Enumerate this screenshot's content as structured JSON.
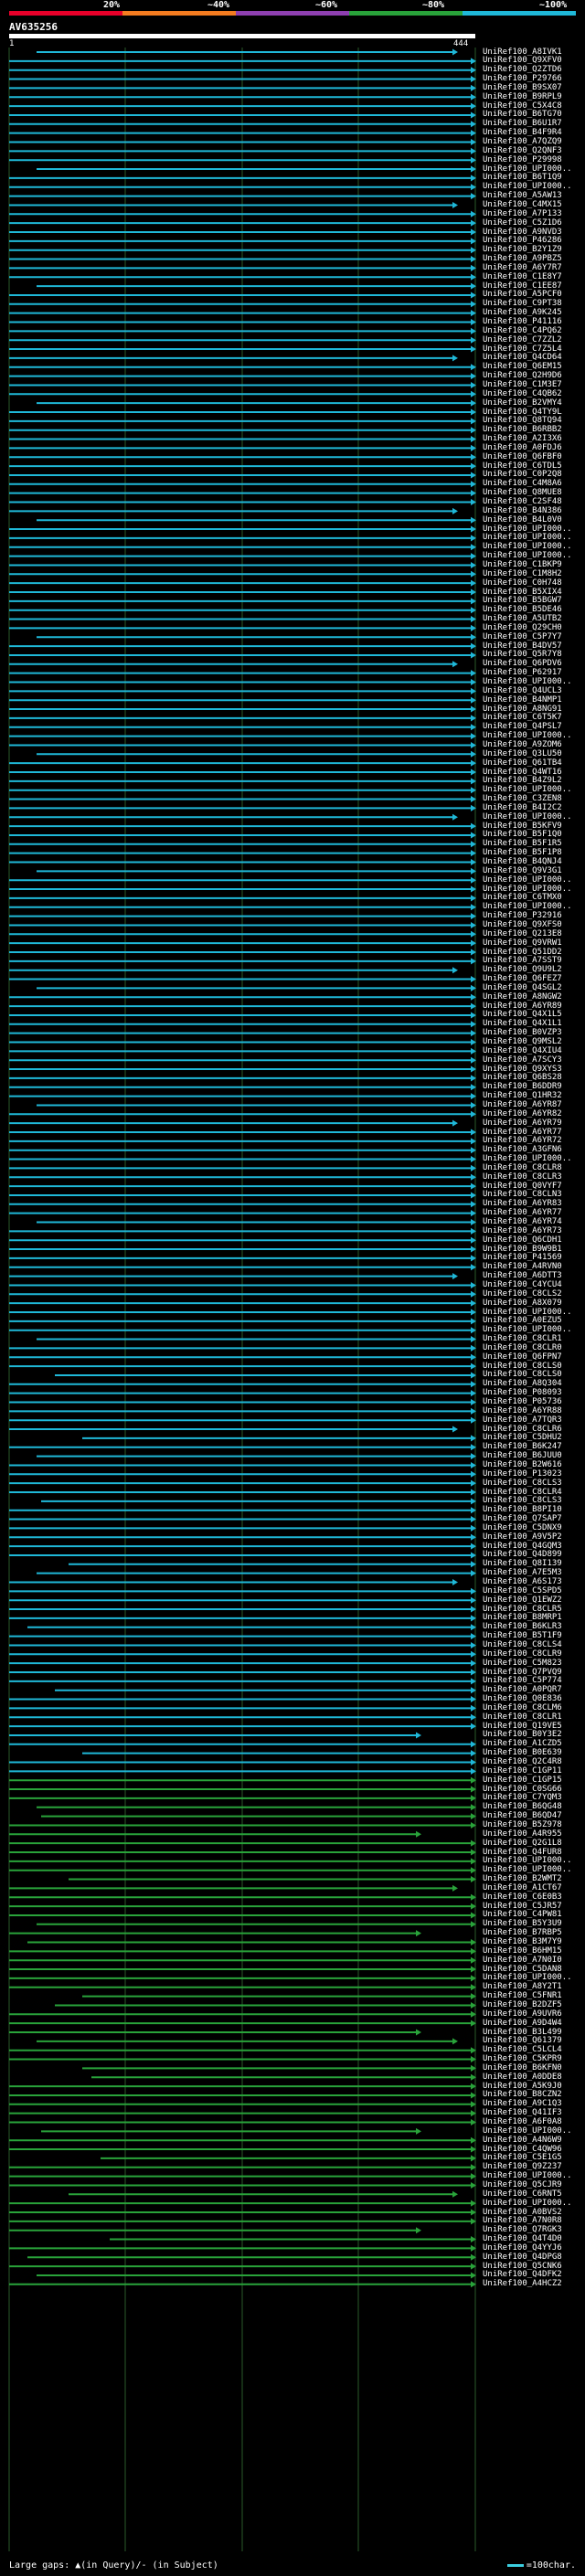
{
  "legend": {
    "ticks": [
      "20%",
      "~40%",
      "~60%",
      "~80%",
      "~100%"
    ],
    "colors": [
      "#e8002a",
      "#f47c20",
      "#8e3fb0",
      "#29a33a",
      "#1fb8d8"
    ]
  },
  "query": {
    "name": "AV635256",
    "start": "1",
    "end": "444"
  },
  "hits": {
    "labels": [
      "UniRef100_A8IVK1",
      "UniRef100_Q9XFV0",
      "UniRef100_Q2ZTD6",
      "UniRef100_P29766",
      "UniRef100_B9SX07",
      "UniRef100_B9RPL9",
      "UniRef100_C5X4C8",
      "UniRef100_B6TG70",
      "UniRef100_B6U1R7",
      "UniRef100_B4F9R4",
      "UniRef100_A7QZQ9",
      "UniRef100_Q2QNF3",
      "UniRef100_P29998",
      "UniRef100_UPI000..",
      "UniRef100_B6T1Q9",
      "UniRef100_UPI000..",
      "UniRef100_A5AW13",
      "UniRef100_C4MX15",
      "UniRef100_A7P133",
      "UniRef100_C5Z1D6",
      "UniRef100_A9NVD3",
      "UniRef100_P46286",
      "UniRef100_B2Y1Z9",
      "UniRef100_A9PBZ5",
      "UniRef100_A6Y7R7",
      "UniRef100_C1E8Y7",
      "UniRef100_C1EE87",
      "UniRef100_A5PCF0",
      "UniRef100_C9PT38",
      "UniRef100_A9K245",
      "UniRef100_P41116",
      "UniRef100_C4PQ62",
      "UniRef100_C7ZZL2",
      "UniRef100_C7Z5L4",
      "UniRef100_Q4CD64",
      "UniRef100_Q6EM15",
      "UniRef100_Q2H9D6",
      "UniRef100_C1M3E7",
      "UniRef100_C4QB62",
      "UniRef100_B2VMY4",
      "UniRef100_Q4TY9L",
      "UniRef100_Q8TQ94",
      "UniRef100_B6RBB2",
      "UniRef100_A2I3X6",
      "UniRef100_A0FDJ6",
      "UniRef100_Q6FBF0",
      "UniRef100_C6TDL5",
      "UniRef100_C0P2Q8",
      "UniRef100_C4M8A6",
      "UniRef100_Q8MUE8",
      "UniRef100_C2SF48",
      "UniRef100_B4N386",
      "UniRef100_B4L0V0",
      "UniRef100_UPI000..",
      "UniRef100_UPI000..",
      "UniRef100_UPI000..",
      "UniRef100_UPI000..",
      "UniRef100_C1BKP9",
      "UniRef100_C1M8H2",
      "UniRef100_C0H748",
      "UniRef100_B5XIX4",
      "UniRef100_B5BGW7",
      "UniRef100_B5DE46",
      "UniRef100_A5UTB2",
      "UniRef100_Q29CH0",
      "UniRef100_C5P7Y7",
      "UniRef100_B4DV57",
      "UniRef100_Q5R7Y8",
      "UniRef100_Q6PDV6",
      "UniRef100_P62917",
      "UniRef100_UPI000..",
      "UniRef100_Q4UCL3",
      "UniRef100_B4NMP1",
      "UniRef100_A8NG91",
      "UniRef100_C6T5K7",
      "UniRef100_Q4PSL7",
      "UniRef100_UPI000..",
      "UniRef100_A9ZOM6",
      "UniRef100_Q3LU50",
      "UniRef100_Q61TB4",
      "UniRef100_Q4WT16",
      "UniRef100_B4Z9L2",
      "UniRef100_UPI000..",
      "UniRef100_C3ZEN8",
      "UniRef100_B4I2C2",
      "UniRef100_UPI000..",
      "UniRef100_B5KFV9",
      "UniRef100_B5F1Q0",
      "UniRef100_B5F1R5",
      "UniRef100_B5F1P8",
      "UniRef100_B4QNJ4",
      "UniRef100_Q9V3G1",
      "UniRef100_UPI000..",
      "UniRef100_UPI000..",
      "UniRef100_C6TMX0",
      "UniRef100_UPI000..",
      "UniRef100_P32916",
      "UniRef100_Q9XFS0",
      "UniRef100_Q213E8",
      "UniRef100_Q9VRW1",
      "UniRef100_Q51DD2",
      "UniRef100_A7SST9",
      "UniRef100_Q9U9L2",
      "UniRef100_Q6FEZ7",
      "UniRef100_Q4SGL2",
      "UniRef100_A8NGW2",
      "UniRef100_A6YR89",
      "UniRef100_Q4X1L5",
      "UniRef100_Q4X1L1",
      "UniRef100_B0VZP3",
      "UniRef100_Q9MSL2",
      "UniRef100_Q4XIU4",
      "UniRef100_A7SCY3",
      "UniRef100_Q9XYS3",
      "UniRef100_Q6BS28",
      "UniRef100_B6DDR9",
      "UniRef100_Q1HR32",
      "UniRef100_A6YR87",
      "UniRef100_A6YR82",
      "UniRef100_A6YR79",
      "UniRef100_A6YR77",
      "UniRef100_A6YR72",
      "UniRef100_A3GFN6",
      "UniRef100_UPI000..",
      "UniRef100_C8CLR8",
      "UniRef100_C8CLR3",
      "UniRef100_Q0VYF7",
      "UniRef100_C8CLN3",
      "UniRef100_A6YR83",
      "UniRef100_A6YR77",
      "UniRef100_A6YR74",
      "UniRef100_A6YR73",
      "UniRef100_Q6CDH1",
      "UniRef100_B9W9B1",
      "UniRef100_P41569",
      "UniRef100_A4RVN0",
      "UniRef100_A6DTT3",
      "UniRef100_C4YCU4",
      "UniRef100_C8CLS2",
      "UniRef100_A8X079",
      "UniRef100_UPI000..",
      "UniRef100_A0EZU5",
      "UniRef100_UPI000..",
      "UniRef100_C8CLR1",
      "UniRef100_C8CLR0",
      "UniRef100_Q6FPN7",
      "UniRef100_C8CLS0",
      "UniRef100_C8CLS0",
      "UniRef100_A8Q304",
      "UniRef100_P08093",
      "UniRef100_P05736",
      "UniRef100_A6YR88",
      "UniRef100_A7TQR3",
      "UniRef100_C8CLR6",
      "UniRef100_C5DHU2",
      "UniRef100_B6K247",
      "UniRef100_B6JUU0",
      "UniRef100_B2W616",
      "UniRef100_P13023",
      "UniRef100_C8CLS3",
      "UniRef100_C8CLR4",
      "UniRef100_C8CLS3",
      "UniRef100_B8PI10",
      "UniRef100_Q7SAP7",
      "UniRef100_C5DNX9",
      "UniRef100_A9V5P2",
      "UniRef100_Q4GQM3",
      "UniRef100_Q4D899",
      "UniRef100_Q8I139",
      "UniRef100_A7E5M3",
      "UniRef100_A6S173",
      "UniRef100_C5SPD5",
      "UniRef100_Q1EWZ2",
      "UniRef100_C8CLR5",
      "UniRef100_B8MRP1",
      "UniRef100_B6KLR3",
      "UniRef100_B5T1F9",
      "UniRef100_C8CLS4",
      "UniRef100_C8CLR9",
      "UniRef100_C5M823",
      "UniRef100_Q7PVQ9",
      "UniRef100_C5P774",
      "UniRef100_A0PQR7",
      "UniRef100_Q0E836",
      "UniRef100_C8CLM6",
      "UniRef100_C8CLR1",
      "UniRef100_Q19VE5",
      "UniRef100_B0Y3E2",
      "UniRef100_A1CZD5",
      "UniRef100_B0E639",
      "UniRef100_Q2C4R8",
      "UniRef100_C1GP11",
      "UniRef100_C1GP15",
      "UniRef100_C0SG66",
      "UniRef100_C7YQM3",
      "UniRef100_B6QG48",
      "UniRef100_B6QD47",
      "UniRef100_B5Z978",
      "UniRef100_A4R955",
      "UniRef100_Q2G1L8",
      "UniRef100_Q4FUR8",
      "UniRef100_UPI000..",
      "UniRef100_UPI000..",
      "UniRef100_B2WMT2",
      "UniRef100_A1CT67",
      "UniRef100_C6E0B3",
      "UniRef100_C5JR57",
      "UniRef100_C4PW81",
      "UniRef100_B5Y3U9",
      "UniRef100_B7RBP5",
      "UniRef100_B3M7Y9",
      "UniRef100_B6HM15",
      "UniRef100_A7N0I0",
      "UniRef100_C5DAN8",
      "UniRef100_UPI000..",
      "UniRef100_A8Y2T1",
      "UniRef100_C5FNR1",
      "UniRef100_B2DZF5",
      "UniRef100_A9UVR6",
      "UniRef100_A9D4W4",
      "UniRef100_B3L499",
      "UniRef100_Q61379",
      "UniRef100_C5LCL4",
      "UniRef100_C5KPR9",
      "UniRef100_B6KFN0",
      "UniRef100_A0DDE8",
      "UniRef100_A5K9J0",
      "UniRef100_B8CZN2",
      "UniRef100_A9C1Q3",
      "UniRef100_Q41IF3",
      "UniRef100_A6F0A8",
      "UniRef100_UPI000..",
      "UniRef100_A4N6W9",
      "UniRef100_C4QW96",
      "UniRef100_C5E1G5",
      "UniRef100_Q9Z237",
      "UniRef100_UPI000..",
      "UniRef100_Q5CJR9",
      "UniRef100_C6RNT5",
      "UniRef100_UPI000..",
      "UniRef100_A0BVS2",
      "UniRef100_A7N0R8",
      "UniRef100_Q7RGK3",
      "UniRef100_Q4T4D0",
      "UniRef100_Q4YYJ6",
      "UniRef100_Q4DPG8",
      "UniRef100_Q5CNK6",
      "UniRef100_Q4DFK2",
      "UniRef100_A4HCZ2"
    ]
  },
  "footer": {
    "gaps_text": "Large gaps: ▲(in Query)/- (in Subject)",
    "scale_text": "=100char."
  }
}
